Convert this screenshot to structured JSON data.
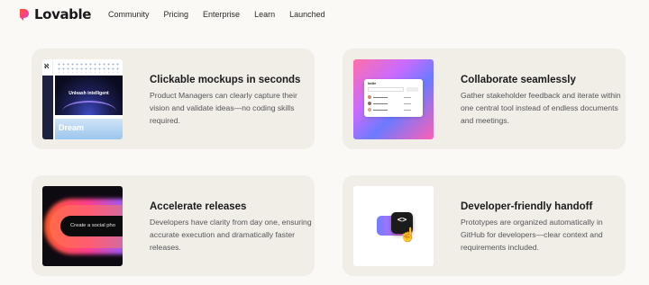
{
  "nav": {
    "logo_text": "Lovable",
    "links": [
      "Community",
      "Pricing",
      "Enterprise",
      "Learn",
      "Launched"
    ]
  },
  "colors": {
    "page_bg": "#fbf9f5",
    "card_bg": "#f1eee8",
    "logo_gradient": [
      "#ff5a2a",
      "#ff3d8b",
      "#8a5cff"
    ]
  },
  "cards": [
    {
      "title": "Clickable mockups in seconds",
      "description": "Product Managers can clearly capture their vision and validate ideas—no coding skills required.",
      "thumb": {
        "hero_text": "Unleash intelligent",
        "banner_text": "Dream"
      }
    },
    {
      "title": "Collaborate seamlessly",
      "description": "Gather stakeholder feedback and iterate within one central tool instead of endless documents and meetings.",
      "thumb": {
        "panel_title": "Invite"
      }
    },
    {
      "title": "Accelerate releases",
      "description": "Developers have clarity from day one, ensuring accurate execution and dramatically faster releases.",
      "thumb": {
        "prompt_text": "Create a social pho"
      }
    },
    {
      "title": "Developer-friendly handoff",
      "description": "Prototypes are organized automatically in GitHub for developers—clear context and requirements included.",
      "thumb": {
        "code_glyph": "<>",
        "cursor_glyph": "☝"
      }
    }
  ]
}
